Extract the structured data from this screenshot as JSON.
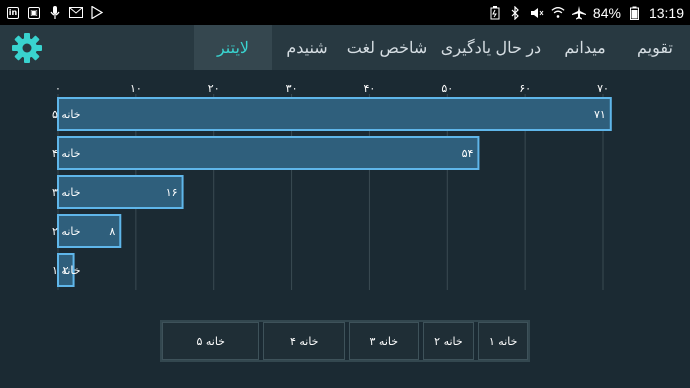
{
  "status_bar": {
    "battery": "84%",
    "time": "13:19",
    "left_icons": [
      "linkedin-icon",
      "photo-icon",
      "microphone-icon",
      "email-icon",
      "play-store-icon"
    ],
    "right_icons": [
      "battery-saver-icon",
      "bluetooth-icon",
      "mute-icon",
      "wifi-icon",
      "airplane-icon",
      "battery-icon"
    ]
  },
  "settings": {
    "icon": "gear-icon",
    "color": "#39d3cf"
  },
  "tabs": [
    {
      "label": "تقویم"
    },
    {
      "label": "میدانم"
    },
    {
      "label": "در حال یادگیری"
    },
    {
      "label": "شاخص لغت"
    },
    {
      "label": "شنیدم"
    },
    {
      "label": "لایتنر"
    }
  ],
  "active_tab": "لایتنر",
  "chart_data": {
    "type": "bar",
    "orientation": "horizontal",
    "categories": [
      "خانه ۵",
      "خانه ۴",
      "خانه ۳",
      "خانه ۲",
      "خانه ۱"
    ],
    "values": [
      71,
      54,
      16,
      8,
      2
    ],
    "value_labels": [
      "۷۱",
      "۵۴",
      "۱۶",
      "۸",
      "۲"
    ],
    "xlim": [
      0,
      70
    ],
    "x_ticks": [
      "۰",
      "۱۰",
      "۲۰",
      "۳۰",
      "۴۰",
      "۵۰",
      "۶۰",
      "۷۰"
    ],
    "x_axis_position": "top",
    "grid": true,
    "bar_fill": "#2f5f7c",
    "bar_stroke": "#5fb6ea"
  },
  "legend": {
    "items": [
      "خانه ۱",
      "خانه ۲",
      "خانه ۳",
      "خانه ۴",
      "خانه ۵"
    ]
  }
}
